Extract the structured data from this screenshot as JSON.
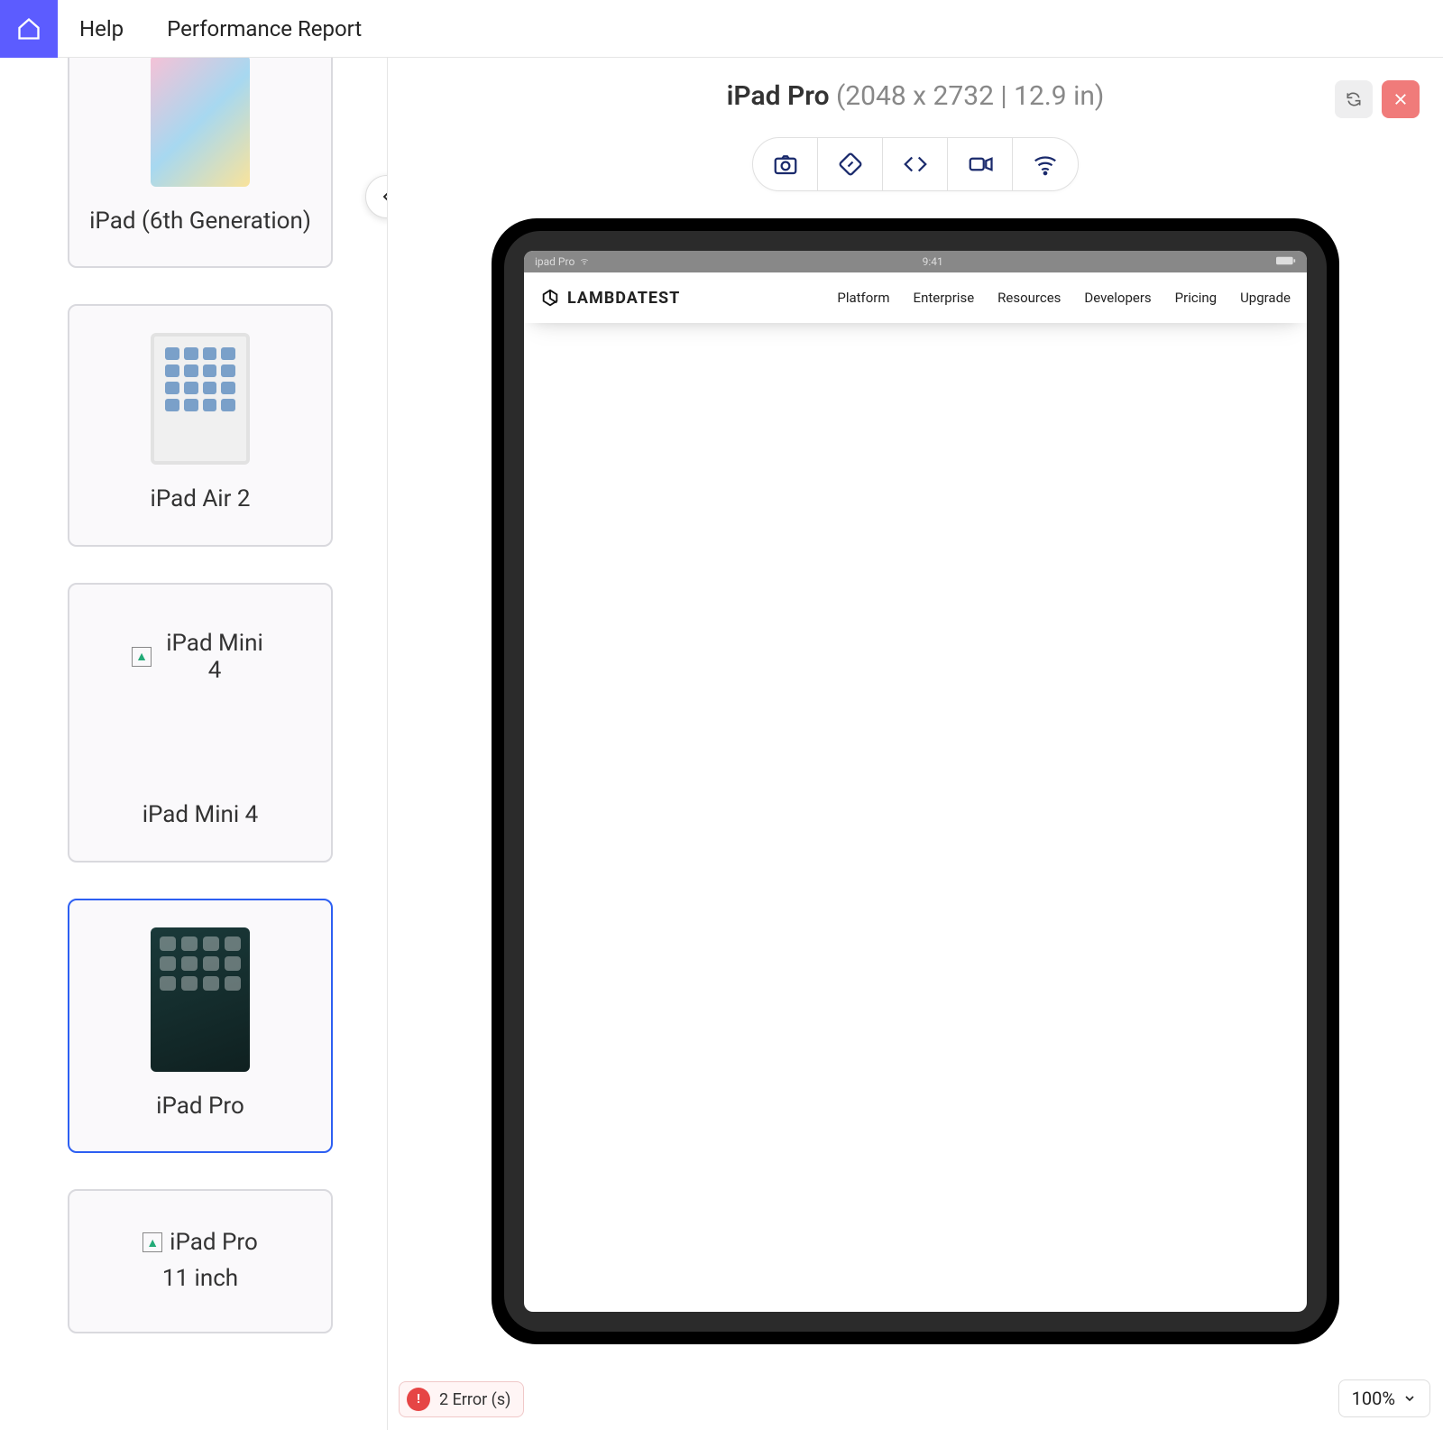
{
  "topbar": {
    "help": "Help",
    "perf": "Performance Report"
  },
  "sidebar": {
    "devices": [
      {
        "id": "ipad-6",
        "label": "iPad (6th Generation)"
      },
      {
        "id": "ipad-air2",
        "label": "iPad Air 2"
      },
      {
        "id": "ipad-mini4",
        "label": "iPad Mini 4",
        "brokenAlt": "iPad Mini 4"
      },
      {
        "id": "ipad-pro",
        "label": "iPad Pro",
        "selected": true
      },
      {
        "id": "ipad-pro-11",
        "label": "",
        "brokenAlt": "iPad Pro 11 inch"
      }
    ]
  },
  "main": {
    "deviceName": "iPad Pro ",
    "deviceSpec": "(2048 x 2732 | 12.9 in)"
  },
  "frame": {
    "statusLeft": "ipad Pro",
    "statusTime": "9:41",
    "brand": "LAMBDATEST",
    "nav": [
      "Platform",
      "Enterprise",
      "Resources",
      "Developers",
      "Pricing",
      "Upgrade"
    ]
  },
  "bottom": {
    "errorBadge": "!",
    "errorText": "2 Error (s)",
    "zoom": "100%"
  }
}
